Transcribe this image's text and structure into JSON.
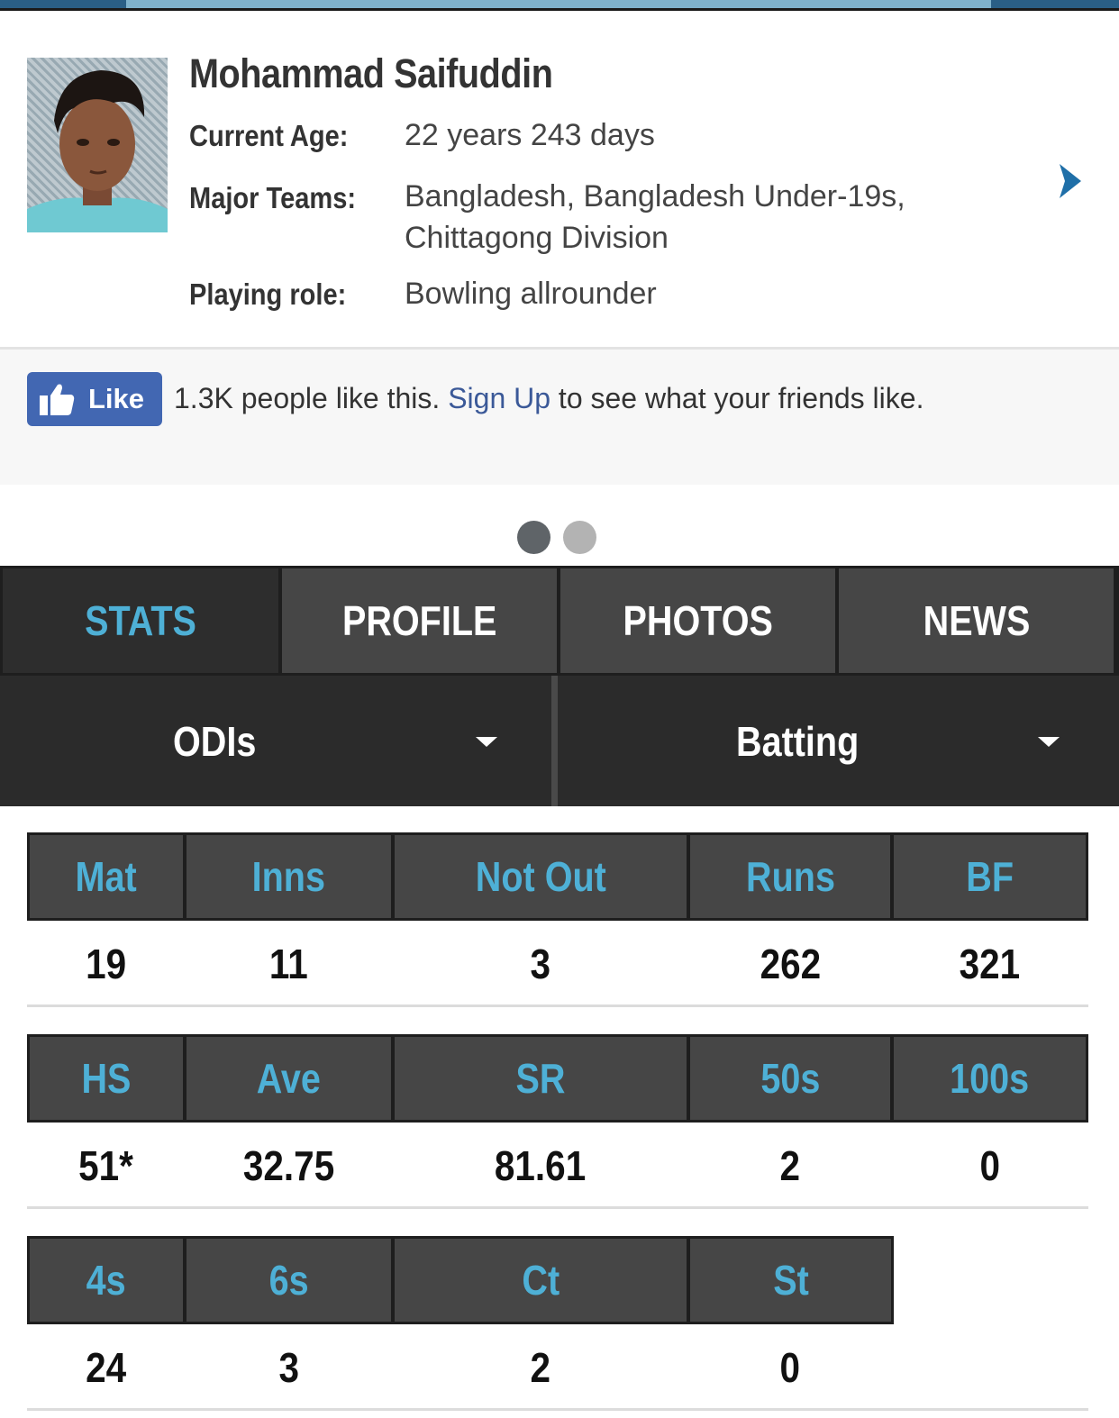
{
  "player": {
    "name": "Mohammad Saifuddin",
    "info": [
      {
        "label": "Current Age:",
        "value": "22 years 243 days"
      },
      {
        "label": "Major Teams:",
        "value": "Bangladesh, Bangladesh Under-19s, Chittagong Division"
      },
      {
        "label": "Playing role:",
        "value": "Bowling allrounder"
      }
    ],
    "next_icon": "chevron-right-icon"
  },
  "like_bar": {
    "button_label": "Like",
    "count_text": "1.3K people like this.",
    "link_text": "Sign Up",
    "after_text": " to see what your friends like.",
    "button_color": "#4267b2"
  },
  "pager": {
    "pages": 2,
    "current": 1
  },
  "tabs": [
    {
      "label": "STATS",
      "active": true
    },
    {
      "label": "PROFILE",
      "active": false
    },
    {
      "label": "PHOTOS",
      "active": false
    },
    {
      "label": "NEWS",
      "active": false
    }
  ],
  "selectors": {
    "format": "ODIs",
    "type": "Batting"
  },
  "stats": {
    "table1": {
      "headers": [
        "Mat",
        "Inns",
        "Not Out",
        "Runs",
        "BF"
      ],
      "values": [
        "19",
        "11",
        "3",
        "262",
        "321"
      ]
    },
    "table2": {
      "headers": [
        "HS",
        "Ave",
        "SR",
        "50s",
        "100s"
      ],
      "values": [
        "51*",
        "32.75",
        "81.61",
        "2",
        "0"
      ]
    },
    "table3": {
      "headers": [
        "4s",
        "6s",
        "Ct",
        "St"
      ],
      "values": [
        "24",
        "3",
        "2",
        "0"
      ]
    }
  },
  "colors": {
    "accent": "#4eb0d6",
    "header_cell": "#464646",
    "dark": "#1e1e1e"
  }
}
